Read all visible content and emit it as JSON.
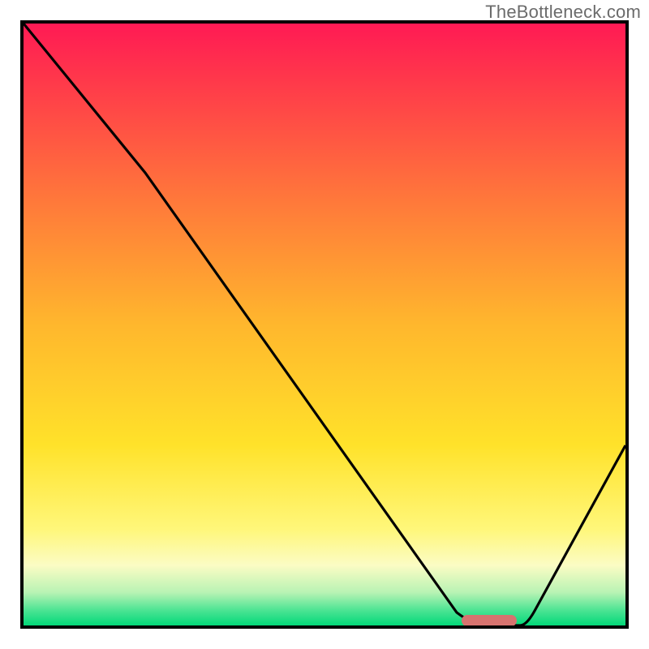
{
  "watermark": "TheBottleneck.com",
  "chart_data": {
    "type": "line",
    "title": "",
    "xlabel": "",
    "ylabel": "",
    "xlim": [
      0,
      100
    ],
    "ylim": [
      0,
      100
    ],
    "series": [
      {
        "name": "bottleneck-curve",
        "x": [
          0,
          20,
          72,
          78,
          82,
          100
        ],
        "y": [
          100,
          75,
          2,
          0,
          2,
          30
        ]
      }
    ],
    "optimum_band_x": [
      72,
      82
    ],
    "gradient_stops": [
      {
        "pos": 0.0,
        "color": "#ff1a54"
      },
      {
        "pos": 0.1,
        "color": "#ff3a4a"
      },
      {
        "pos": 0.3,
        "color": "#ff7a3a"
      },
      {
        "pos": 0.5,
        "color": "#ffb72d"
      },
      {
        "pos": 0.7,
        "color": "#ffe22a"
      },
      {
        "pos": 0.84,
        "color": "#fff77a"
      },
      {
        "pos": 0.9,
        "color": "#fbfcc4"
      },
      {
        "pos": 0.945,
        "color": "#b9f3b4"
      },
      {
        "pos": 0.975,
        "color": "#4be493"
      },
      {
        "pos": 1.0,
        "color": "#03d879"
      }
    ]
  }
}
